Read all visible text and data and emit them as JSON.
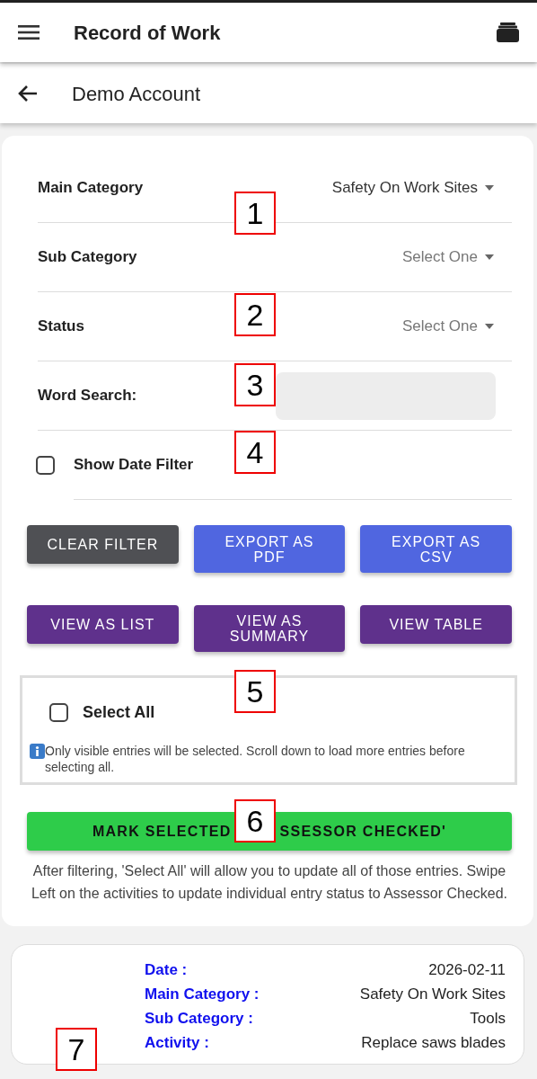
{
  "app_bar": {
    "title": "Record of Work"
  },
  "sub_header": {
    "title": "Demo Account"
  },
  "filters": [
    {
      "kind": "select",
      "label": "Main Category",
      "value": "Safety On Work Sites"
    },
    {
      "kind": "select",
      "label": "Sub Category",
      "placeholder": "Select One"
    },
    {
      "kind": "select",
      "label": "Status",
      "placeholder": "Select One"
    },
    {
      "kind": "text",
      "label": "Word Search:"
    },
    {
      "kind": "checkbox",
      "label": "Show Date Filter",
      "checked": false
    }
  ],
  "button_rows": [
    [
      {
        "label": "CLEAR FILTER",
        "kind": "dark"
      },
      {
        "label": "EXPORT AS PDF",
        "kind": "blue"
      },
      {
        "label": "EXPORT AS CSV",
        "kind": "blue"
      }
    ],
    [
      {
        "label": "VIEW AS LIST",
        "kind": "purple"
      },
      {
        "label": "VIEW AS SUMMARY",
        "kind": "purple"
      },
      {
        "label": "VIEW TABLE",
        "kind": "purple"
      }
    ]
  ],
  "select_all": {
    "label": "Select All",
    "checked": false,
    "note": "Only visible entries will be selected. Scroll down to load more entries before selecting all."
  },
  "mark_button": {
    "label_parts": [
      "MARK SELECTED",
      "SSESSOR CHECKED'"
    ]
  },
  "help_text": "After filtering, 'Select All' will allow you to update all of those entries. Swipe Left on the activities to update individual entry status to Assessor Checked.",
  "entries": [
    {
      "fields": [
        {
          "label": "Date :",
          "value": "2026-02-11"
        },
        {
          "label": "Main Category :",
          "value": "Safety On Work Sites"
        },
        {
          "label": "Sub Category :",
          "value": "Tools"
        },
        {
          "label": "Activity :",
          "value": "Replace saws blades"
        }
      ]
    }
  ],
  "annotations": [
    "1",
    "2",
    "3",
    "4",
    "5",
    "6",
    "7"
  ]
}
